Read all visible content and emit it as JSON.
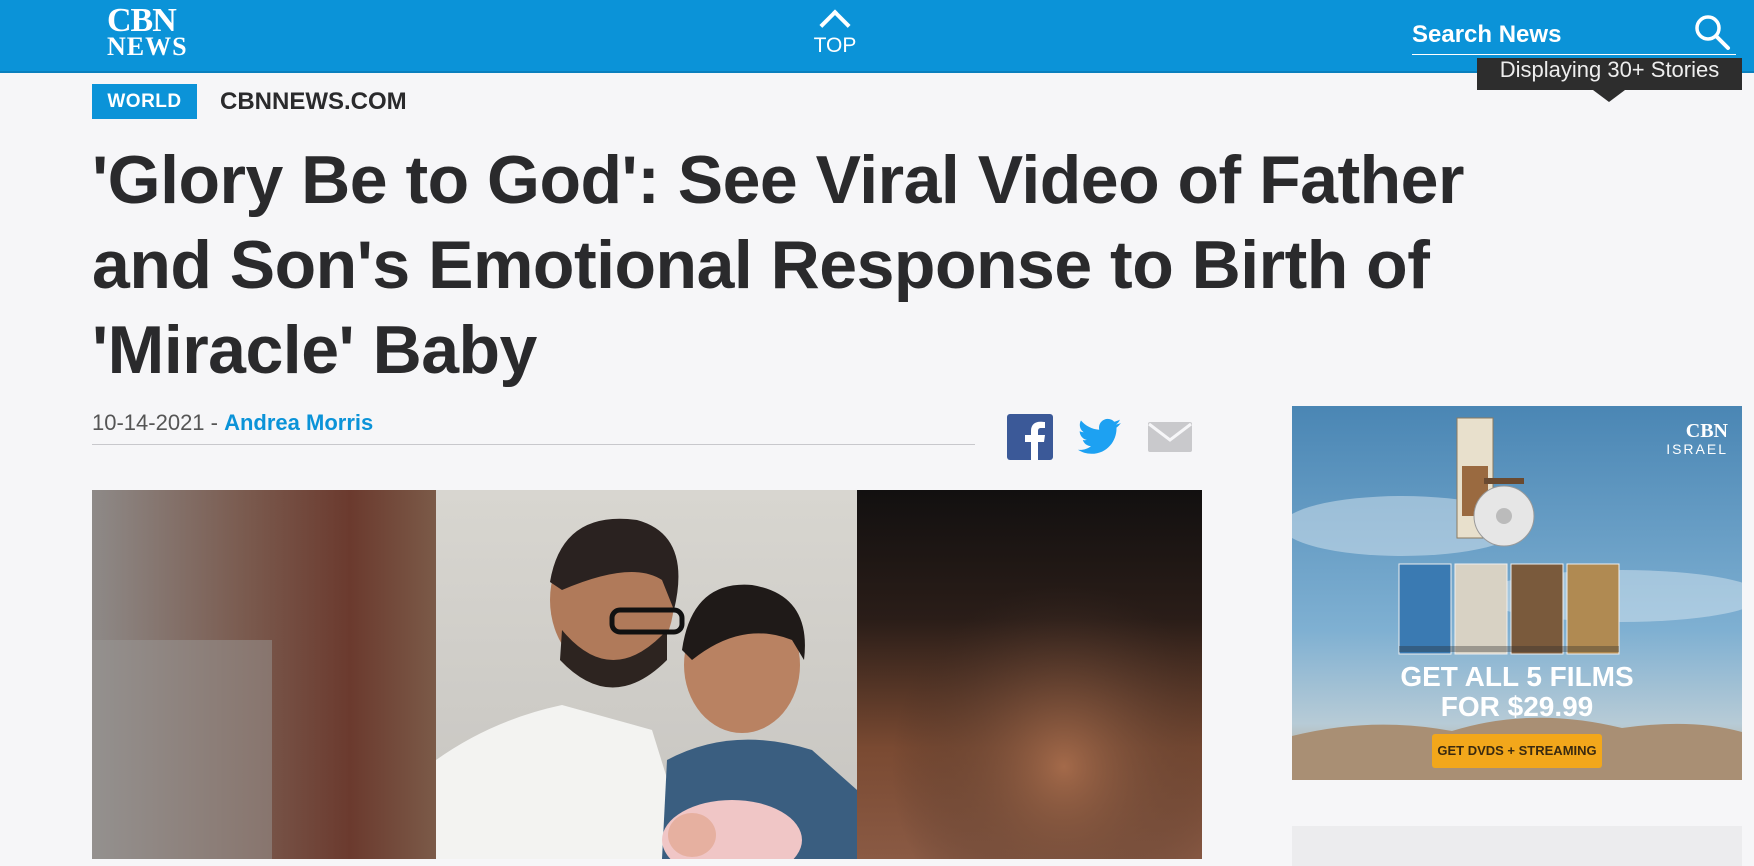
{
  "header": {
    "logo_line1": "CBN",
    "logo_line2": "NEWS",
    "top_label": "TOP",
    "search_placeholder": "Search News",
    "stories_badge": "Displaying 30+ Stories"
  },
  "article": {
    "category": "WORLD",
    "source": "CBNNEWS.COM",
    "headline": "'Glory Be to God': See Viral Video of Father and Son's Emotional Response to Birth of 'Miracle' Baby",
    "date": "10-14-2021 -",
    "author": "Andrea Morris"
  },
  "share": {
    "icons": [
      "facebook-icon",
      "twitter-icon",
      "email-icon"
    ]
  },
  "ad": {
    "brand_line1": "CBN",
    "brand_line2": "ISRAEL",
    "headline_line1": "GET ALL 5 FILMS",
    "headline_line2": "FOR $29.99",
    "button": "GET DVDS + STREAMING"
  },
  "colors": {
    "brand_blue": "#0b93d8",
    "text_dark": "#2a2a2c",
    "ad_button": "#f2a71b"
  }
}
